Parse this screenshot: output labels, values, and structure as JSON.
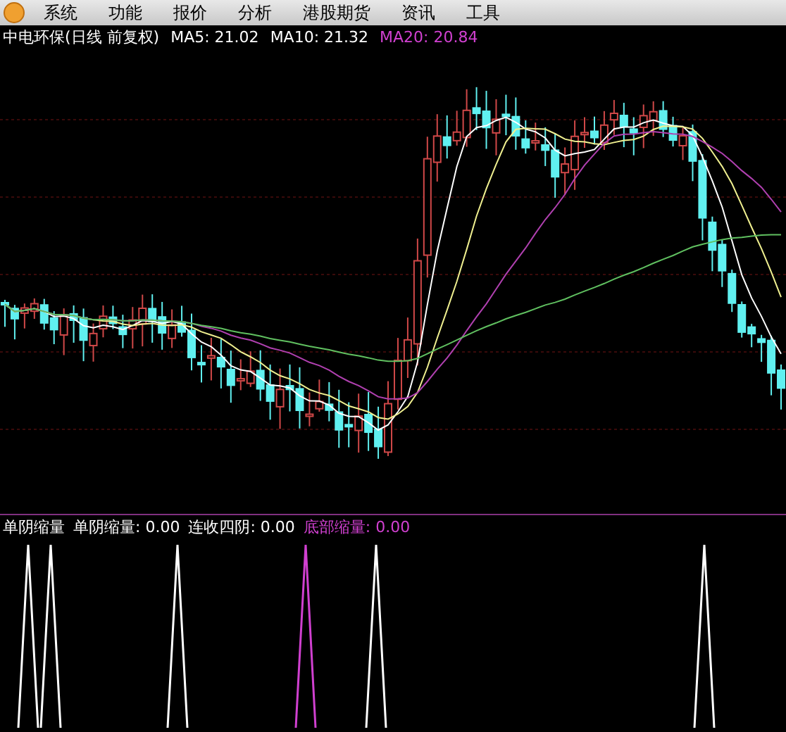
{
  "menu": {
    "items": [
      "系统",
      "功能",
      "报价",
      "分析",
      "港股期货",
      "资讯",
      "工具"
    ]
  },
  "chart_header": {
    "title": "中电环保(日线 前复权)",
    "indicators": [
      {
        "label": "MA5:",
        "value": "21.02",
        "color": "#ffffff"
      },
      {
        "label": "MA10:",
        "value": "21.32",
        "color": "#ffffff"
      },
      {
        "label": "MA20:",
        "value": "20.84",
        "color": "#d040d0"
      }
    ]
  },
  "indicator_panel": {
    "name": "单阴缩量",
    "values": [
      {
        "label": "单阴缩量:",
        "value": "0.00",
        "color": "#ffffff"
      },
      {
        "label": "连收四阴:",
        "value": "0.00",
        "color": "#ffffff"
      },
      {
        "label": "底部缩量:",
        "value": "0.00",
        "color": "#d040d0"
      }
    ]
  }
}
